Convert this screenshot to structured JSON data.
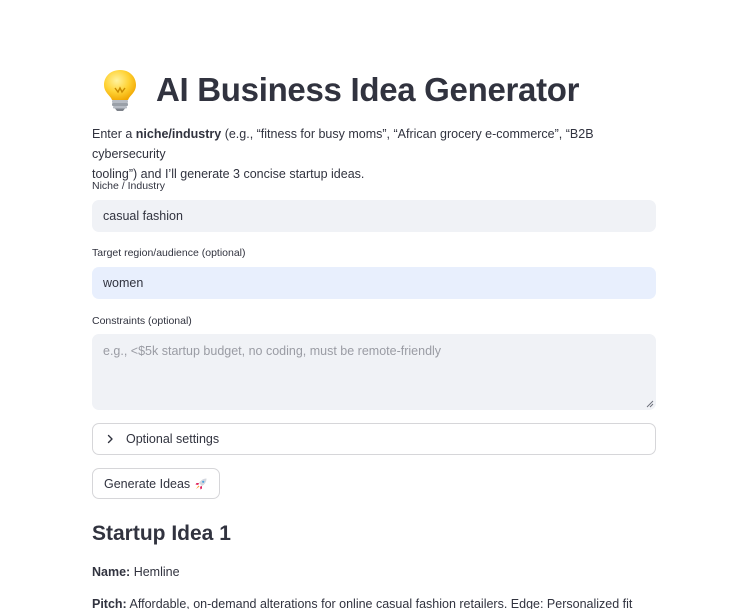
{
  "header": {
    "title": "AI Business Idea Generator",
    "icon": "lightbulb-icon"
  },
  "intro": {
    "prefix": "Enter a ",
    "bold": "niche/industry",
    "line1_rest": " (e.g., “fitness for busy moms”, “African grocery e-commerce”, “B2B cybersecurity",
    "line2": "tooling”) and I’ll generate 3 concise startup ideas."
  },
  "form": {
    "niche": {
      "label": "Niche / Industry",
      "value": "casual fashion"
    },
    "region": {
      "label": "Target region/audience (optional)",
      "value": "women"
    },
    "constraints": {
      "label": "Constraints (optional)",
      "placeholder": "e.g., <$5k startup budget, no coding, must be remote-friendly"
    },
    "optional_settings": {
      "label": "Optional settings"
    },
    "generate_button": {
      "label": "Generate Ideas"
    }
  },
  "results": [
    {
      "heading": "Startup Idea 1",
      "name_label": "Name:",
      "name": "Hemline",
      "pitch_label": "Pitch:",
      "pitch": "Affordable, on-demand alterations for online casual fashion retailers. Edge: Personalized fit"
    }
  ],
  "colors": {
    "text": "#31333f",
    "input_bg": "#f0f2f6",
    "input_focused_bg": "#e8effd",
    "border": "#d6d6d9",
    "placeholder": "#9a9ca4"
  }
}
